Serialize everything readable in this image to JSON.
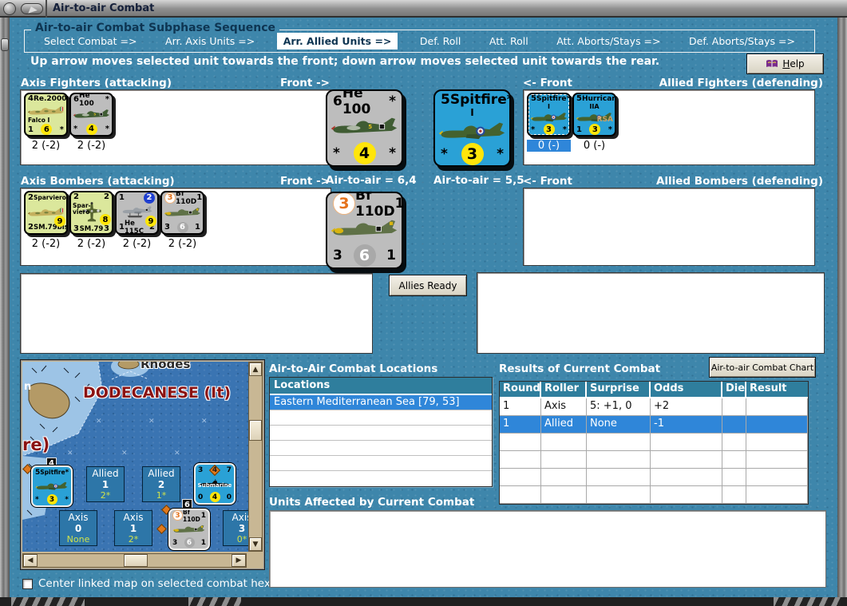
{
  "window": {
    "title": "Air-to-air Combat"
  },
  "sequence": {
    "title": "Air-to-air Combat Subphase Sequence",
    "steps": [
      {
        "label": "Select Combat =>",
        "active": false
      },
      {
        "label": "Arr. Axis Units =>",
        "active": false
      },
      {
        "label": "Arr. Allied Units =>",
        "active": true
      },
      {
        "label": "Def. Roll",
        "active": false
      },
      {
        "label": "Att. Roll",
        "active": false
      },
      {
        "label": "Att. Aborts/Stays =>",
        "active": false
      },
      {
        "label": "Def. Aborts/Stays =>",
        "active": false
      }
    ]
  },
  "instruction": "Up arrow moves selected unit towards the front; down arrow moves selected unit towards the rear.",
  "buttons": {
    "help": "Help",
    "alliesReady": "Allies Ready",
    "combatChart": "Air-to-air Combat Chart"
  },
  "axisFighters": {
    "title": "Axis Fighters (attacking)",
    "front": "Front ->",
    "units": [
      {
        "tl": "4",
        "name": "Re.2000",
        "tr": "*",
        "sub": "Falco I",
        "bl": "1",
        "bm": "6",
        "br": "*",
        "below": "2 (-2)"
      },
      {
        "tl": "6",
        "name": "He 100",
        "tr": "*",
        "bl": "*",
        "bm": "4",
        "br": "*",
        "below": "2 (-2)"
      }
    ]
  },
  "alliedFighters": {
    "front": "<- Front",
    "title": "Allied Fighters (defending)",
    "units": [
      {
        "tl": "5",
        "name": "Spitfire",
        "tr": "*",
        "sub": "I",
        "bl": "*",
        "bm": "3",
        "br": "*",
        "below": "0 (-)",
        "selected": true
      },
      {
        "tl": "5",
        "name": "Hurricane",
        "tr": "*",
        "sub": "IIA",
        "wing": "RSA",
        "bl": "1",
        "bm": "3",
        "br": "*",
        "below": "0 (-)",
        "selected": false
      }
    ]
  },
  "axisBombers": {
    "title": "Axis Bombers (attacking)",
    "front": "Front ->",
    "units": [
      {
        "tl": "2",
        "name": "Sparviero",
        "tr": "3",
        "rating": "9",
        "bl": "2",
        "bname": "SM.79bis",
        "br": "1",
        "below": "2 (-2)"
      },
      {
        "tl": "2",
        "name1": "Spar-",
        "name2": "viero",
        "tr": "2",
        "rating": "8",
        "bl": "3",
        "bname": "SM.79",
        "br": "3",
        "below": "2 (-2)"
      },
      {
        "tl": "1",
        "tr": "2",
        "rating": "9",
        "bl": "1",
        "bname": "He 115C",
        "br": "2",
        "below": "2 (-2)"
      },
      {
        "tl": "3",
        "name": "Bf 110D",
        "tr": "1",
        "bl": "3",
        "bm": "6",
        "br": "1",
        "below": "2 (-2)"
      }
    ]
  },
  "alliedBombers": {
    "front": "<- Front",
    "title": "Allied Bombers (defending)"
  },
  "frontFighterAxis": {
    "tl": "6",
    "name": "He 100",
    "tr": "*",
    "bl": "*",
    "bm": "4",
    "br": "*",
    "rating": "Air-to-air = 6,4"
  },
  "frontFighterAllied": {
    "tl": "5",
    "name": "Spitfire",
    "sub": "I",
    "tr": "*",
    "bl": "*",
    "bm": "3",
    "br": "*",
    "rating": "Air-to-air = 5,5"
  },
  "frontBomberAxis": {
    "tl": "3",
    "name": "Bf 110D",
    "tr": "1",
    "bl": "3",
    "bm": "6",
    "br": "1"
  },
  "map": {
    "rhodes": "Rhodes",
    "region": "DODECANESE (It)",
    "edge1": "n",
    "edge2": "re)",
    "badgeSpit": "4",
    "badgeBf": "6",
    "spit": {
      "tl": "5",
      "name": "Spitfire",
      "tr": "*",
      "bl": "*",
      "bm": "3",
      "br": "*"
    },
    "bf": {
      "tl": "3",
      "name": "Bf 110D",
      "tr": "1",
      "bl": "3",
      "bm": "6",
      "br": "1"
    },
    "sub": {
      "t1": "3",
      "t2": "4",
      "t3": "7",
      "name": "Submarine",
      "b1": "0",
      "b2": "4",
      "b3": "0"
    },
    "stacks": [
      {
        "side": "Allied",
        "num": "1",
        "note": "2*"
      },
      {
        "side": "Allied",
        "num": "2",
        "note": "1*"
      },
      {
        "side": "Axis",
        "num": "0",
        "note": "None"
      },
      {
        "side": "Axis",
        "num": "1",
        "note": "2*"
      },
      {
        "side": "Axis",
        "num": "3",
        "note": "0*"
      }
    ]
  },
  "locations": {
    "title": "Air-to-Air Combat Locations",
    "header": "Locations",
    "selected": "Eastern Mediterranean Sea [79, 53]"
  },
  "results": {
    "title": "Results of Current Combat",
    "headers": [
      "Round",
      "Roller",
      "Surprise",
      "Odds",
      "Die",
      "Result"
    ],
    "row1": [
      "1",
      "Axis",
      "5: +1, 0",
      "+2",
      "",
      ""
    ],
    "row2": [
      "1",
      "Allied",
      "None",
      "-1",
      "",
      ""
    ]
  },
  "unitsAffected": {
    "title": "Units Affected by Current Combat"
  },
  "checkbox": {
    "label": "Center linked map on selected combat hex",
    "checked": false
  },
  "colors": {
    "dialog_bg": "#3e86ab",
    "highlight": "#2f86d9",
    "table_header": "#2f7e9d",
    "axis_italian": "#dbe79c",
    "axis_german": "#bdbdbd",
    "allied_blue": "#2aa1d6",
    "rating_circle": "#ffe50a",
    "map_sea": "#3a74b2"
  }
}
